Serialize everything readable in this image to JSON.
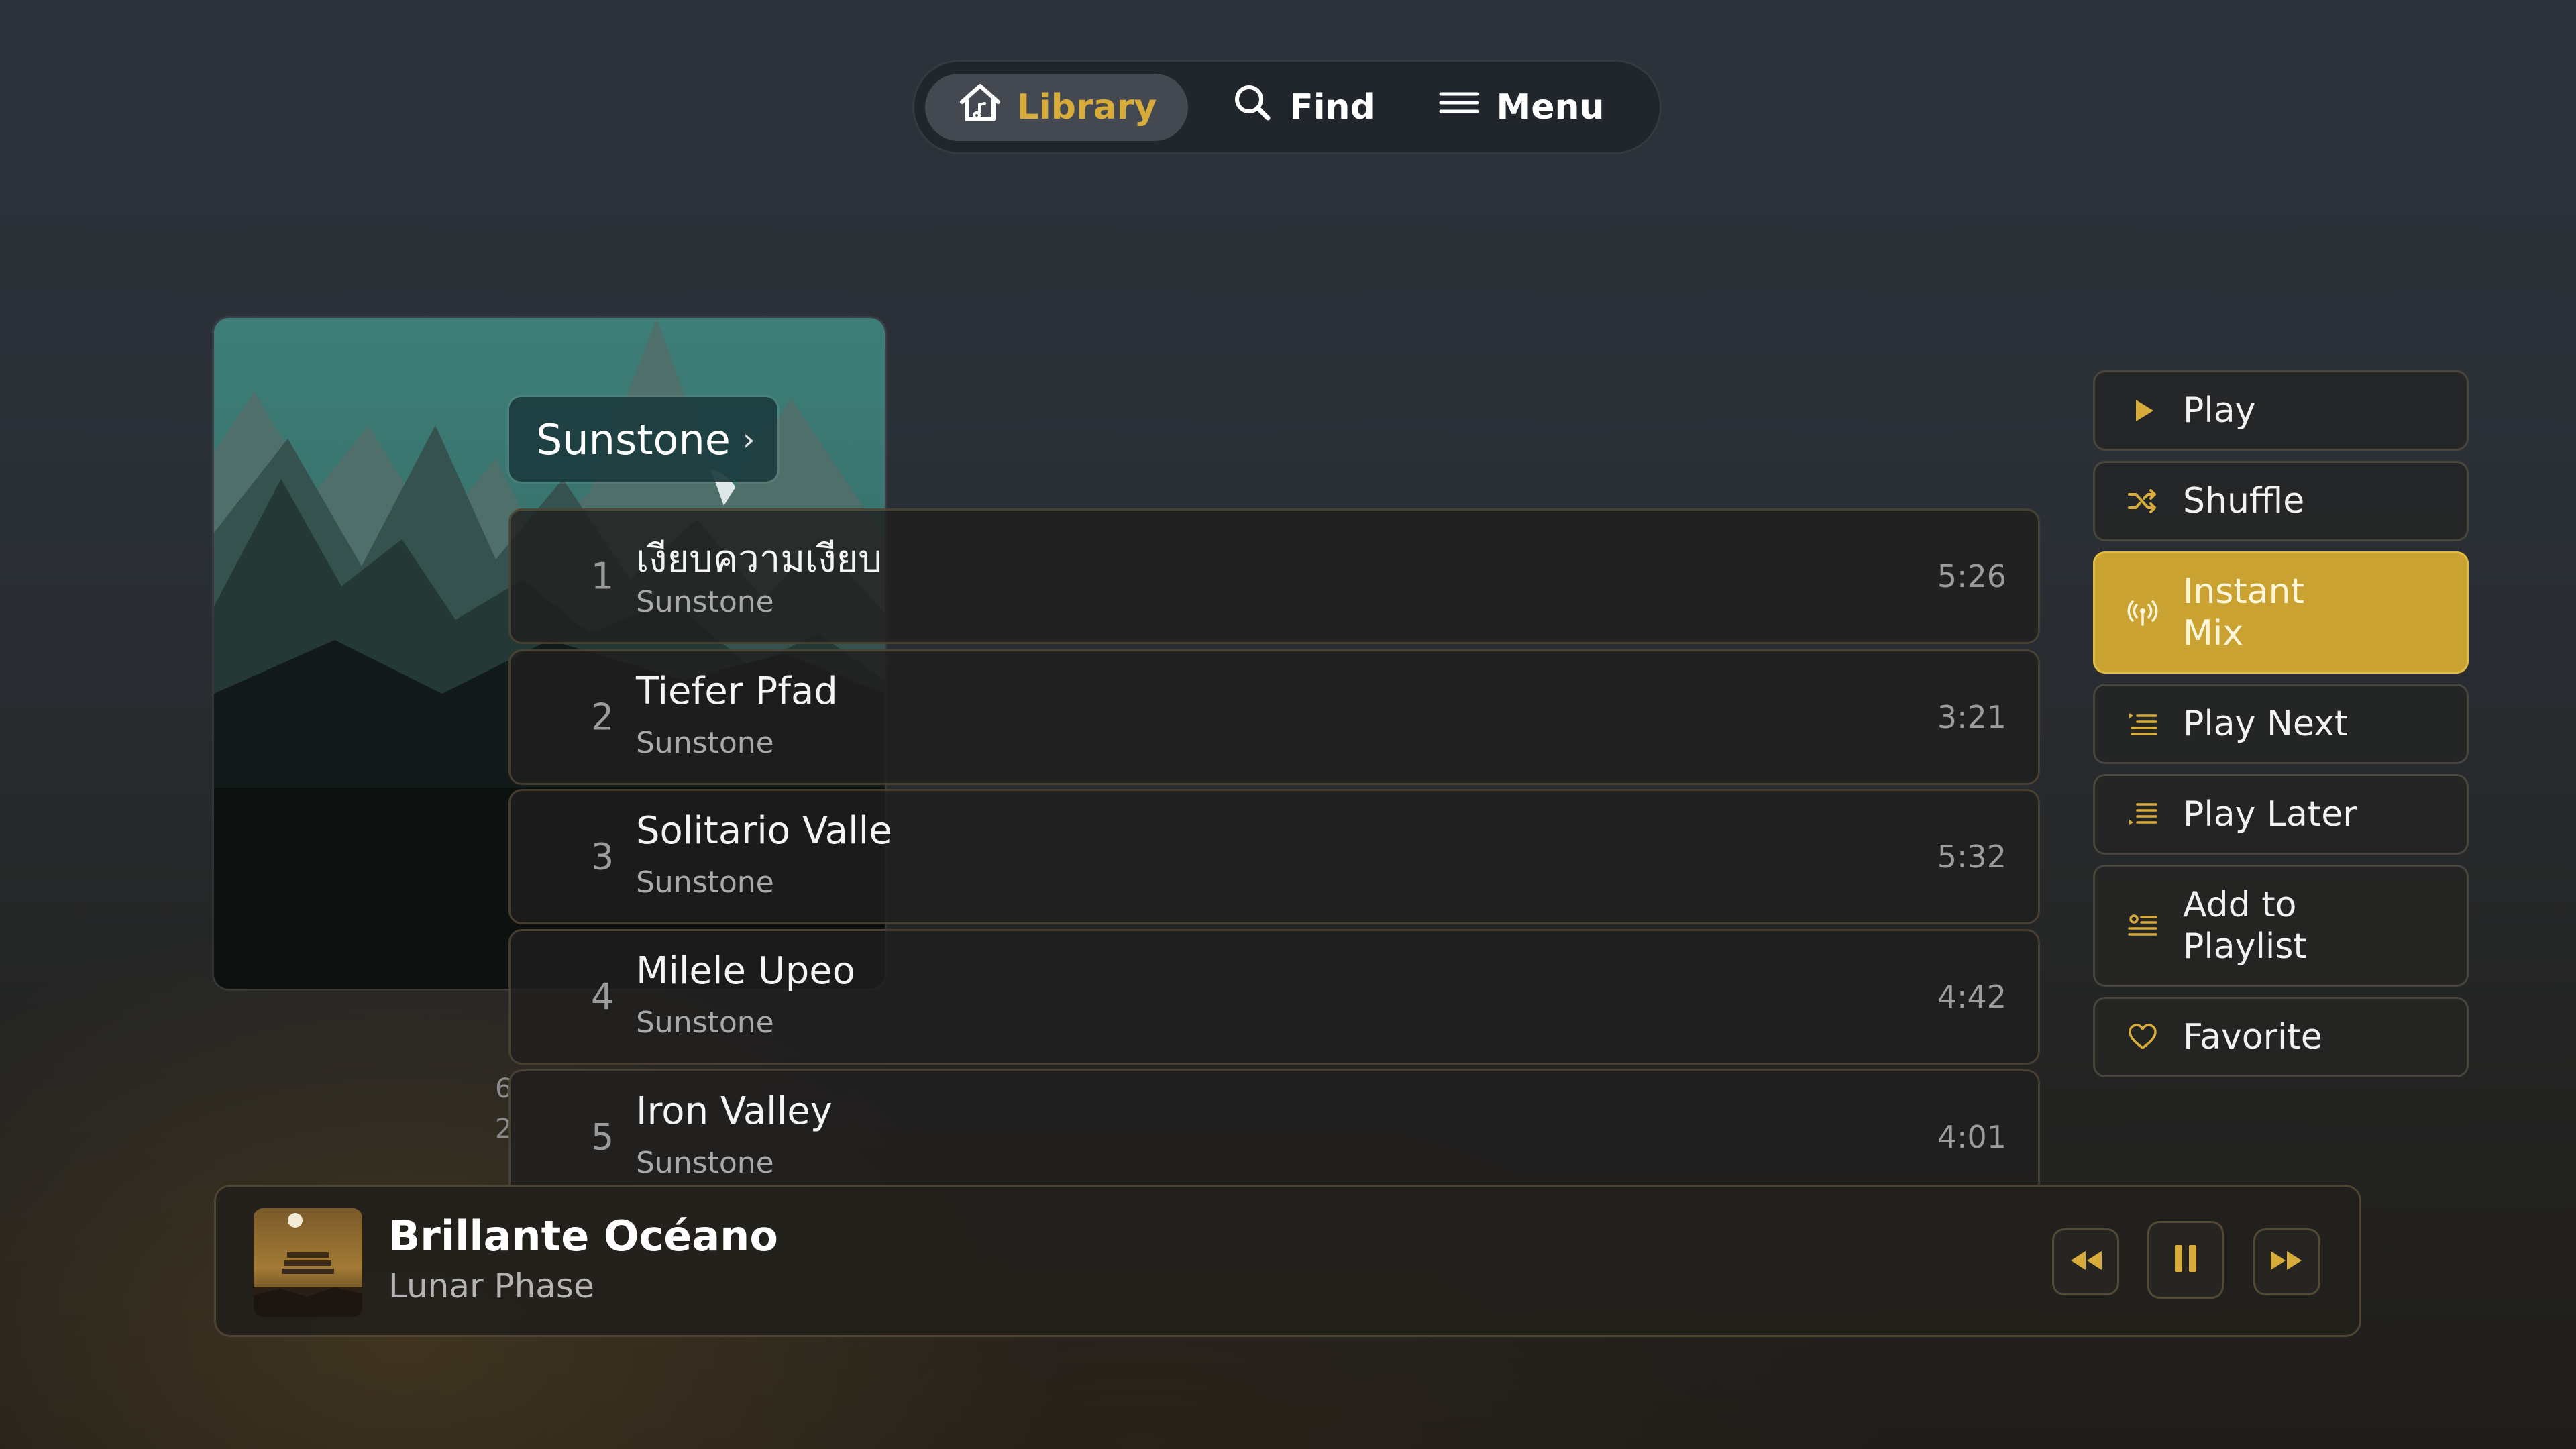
{
  "nav": {
    "library_label": "Library",
    "find_label": "Find",
    "menu_label": "Menu",
    "active": "library",
    "accent_color": "#d8ac3a"
  },
  "album": {
    "title": "Sunstone",
    "side_fragments": [
      "6",
      "2"
    ]
  },
  "tracks": [
    {
      "number": "1",
      "title": "เงียบความเงียบ",
      "artist": "Sunstone",
      "duration": "5:26"
    },
    {
      "number": "2",
      "title": "Tiefer Pfad",
      "artist": "Sunstone",
      "duration": "3:21"
    },
    {
      "number": "3",
      "title": "Solitario Valle",
      "artist": "Sunstone",
      "duration": "5:32"
    },
    {
      "number": "4",
      "title": "Milele Upeo",
      "artist": "Sunstone",
      "duration": "4:42"
    },
    {
      "number": "5",
      "title": "Iron Valley",
      "artist": "Sunstone",
      "duration": "4:01"
    }
  ],
  "actions": {
    "play": {
      "label": "Play",
      "icon": "play-icon"
    },
    "shuffle": {
      "label": "Shuffle",
      "icon": "shuffle-icon"
    },
    "instant_mix": {
      "label_line1": "Instant",
      "label_line2": "Mix",
      "icon": "broadcast-icon",
      "highlighted": true,
      "color": "#c9a232"
    },
    "play_next": {
      "label": "Play Next",
      "icon": "queue-next-icon"
    },
    "play_later": {
      "label": "Play Later",
      "icon": "queue-later-icon"
    },
    "add_to_playlist": {
      "label_line1": "Add to",
      "label_line2": "Playlist",
      "icon": "playlist-add-icon"
    },
    "favorite": {
      "label": "Favorite",
      "icon": "heart-icon"
    }
  },
  "now_playing": {
    "title": "Brillante Océano",
    "artist": "Lunar Phase",
    "state": "playing",
    "controls": [
      "rewind-icon",
      "pause-icon",
      "fast-forward-icon"
    ]
  }
}
